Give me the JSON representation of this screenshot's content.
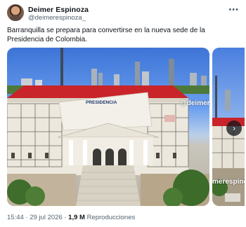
{
  "author": {
    "name": "Deimer Espinoza",
    "handle": "@deimerespinoza_"
  },
  "menu_icon": "more-horizontal-icon",
  "text": "Barranquilla se prepara para convertirse en la nueva sede de la Presidencia de Colombia.",
  "media": {
    "sign_text": "PRESIDENCIA",
    "watermark_1": "@deimer",
    "watermark_2": "merespinoz"
  },
  "next_icon": "chevron-right-icon",
  "meta": {
    "time": "15:44",
    "sep": "·",
    "date": "29 jul 2026",
    "views_count": "1,9 M",
    "views_label": "Reproducciones"
  }
}
